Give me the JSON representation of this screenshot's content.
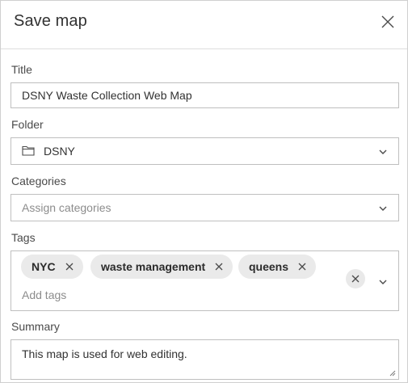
{
  "dialog": {
    "title": "Save map",
    "close_icon": "close-icon"
  },
  "fields": {
    "title": {
      "label": "Title",
      "value": "DSNY Waste Collection Web Map"
    },
    "folder": {
      "label": "Folder",
      "value": "DSNY",
      "icon": "folder-icon"
    },
    "categories": {
      "label": "Categories",
      "placeholder": "Assign categories"
    },
    "tags": {
      "label": "Tags",
      "chips": [
        "NYC",
        "waste management",
        "queens"
      ],
      "placeholder": "Add tags"
    },
    "summary": {
      "label": "Summary",
      "value": "This map is used for web editing."
    }
  }
}
